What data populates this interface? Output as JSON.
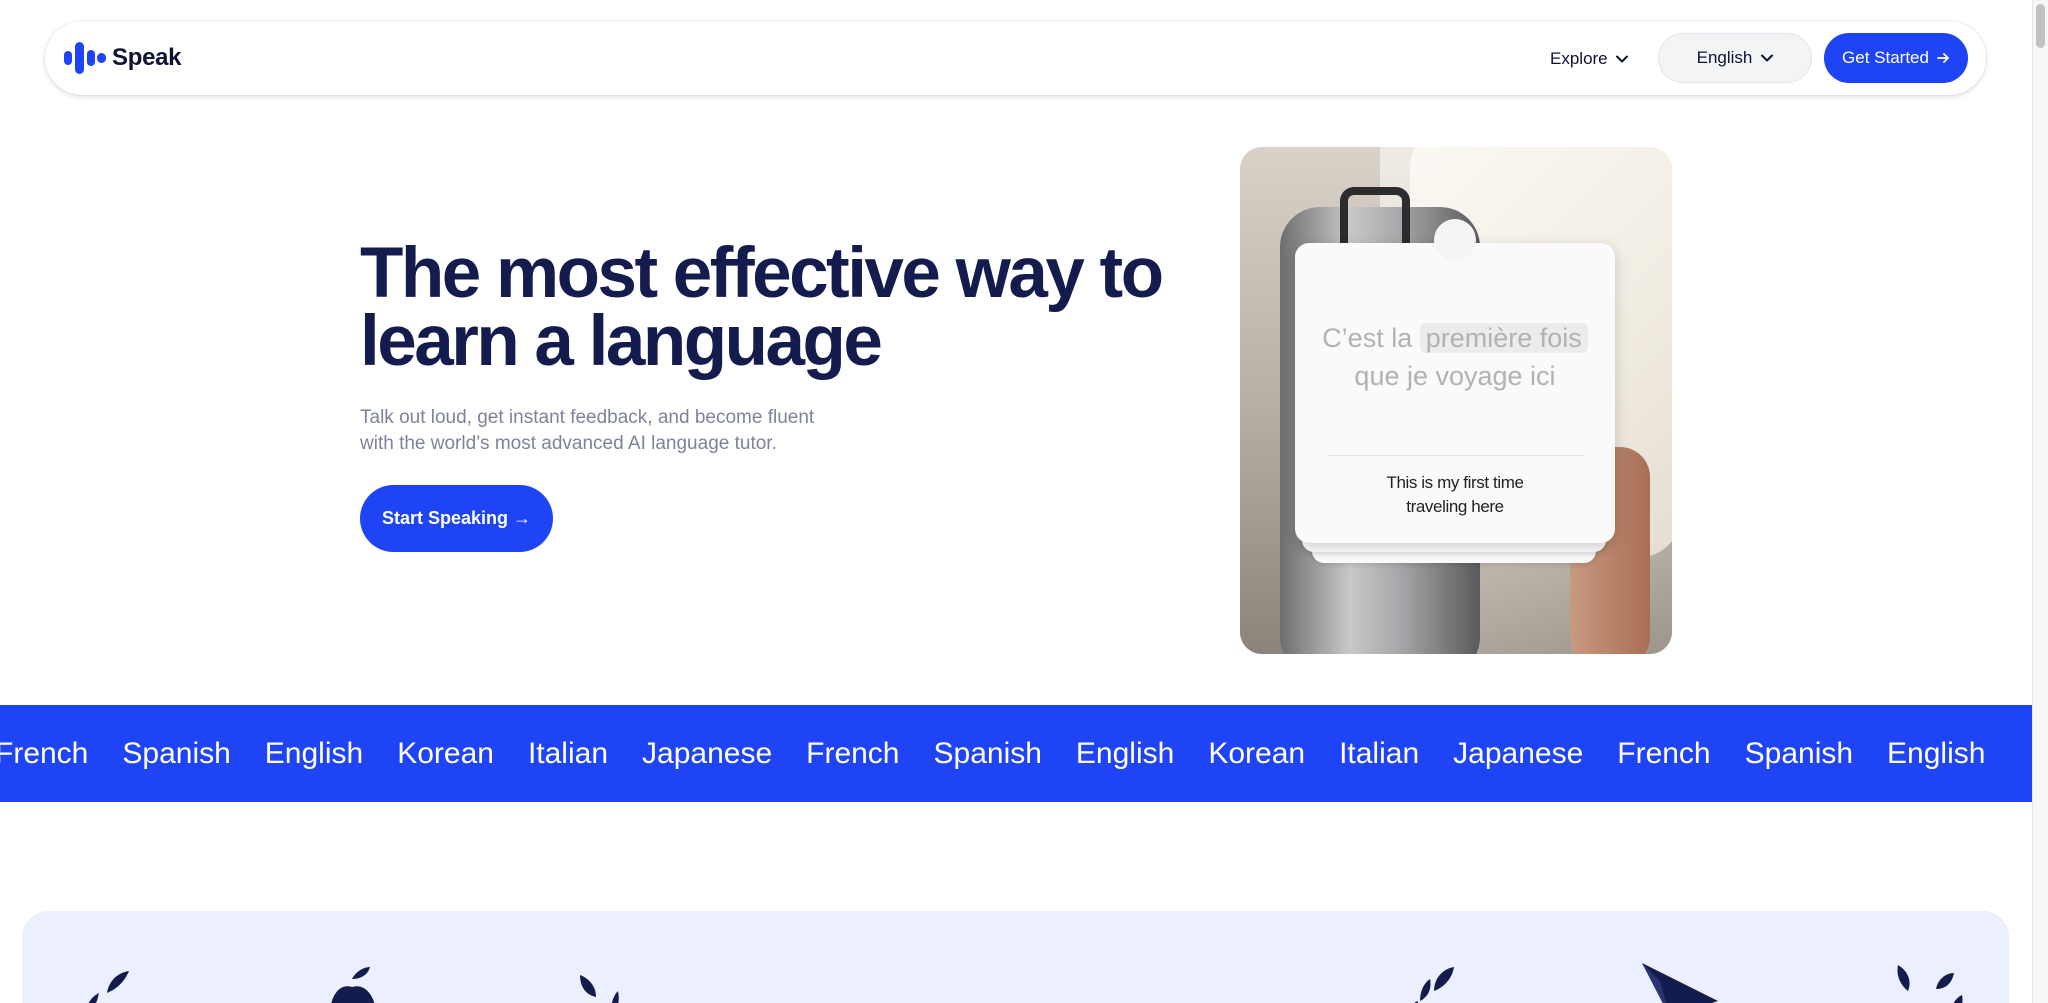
{
  "nav": {
    "brand": "Speak",
    "explore_label": "Explore",
    "language_label": "English",
    "cta_label": "Get Started"
  },
  "hero": {
    "title_line1": "The most effective way to",
    "title_line2": "learn a language",
    "subtitle_line1": "Talk out loud, get instant feedback, and become fluent",
    "subtitle_line2": "with the world’s most advanced AI language tutor.",
    "cta_label": "Start  Speaking →"
  },
  "phrase_card": {
    "target_prefix": "C’est la",
    "target_highlight": "première fois",
    "target_line2": "que je voyage ici",
    "translation_line1": "This is my first time",
    "translation_line2": "traveling here"
  },
  "languages": [
    "French",
    "Spanish",
    "English",
    "Korean",
    "Italian",
    "Japanese",
    "French",
    "Spanish",
    "English",
    "Korean",
    "Italian",
    "Japanese",
    "French",
    "Spanish",
    "English"
  ],
  "colors": {
    "brand_blue": "#1f44f5",
    "heading_navy": "#141b4d",
    "panel_bg": "#eceffd"
  }
}
